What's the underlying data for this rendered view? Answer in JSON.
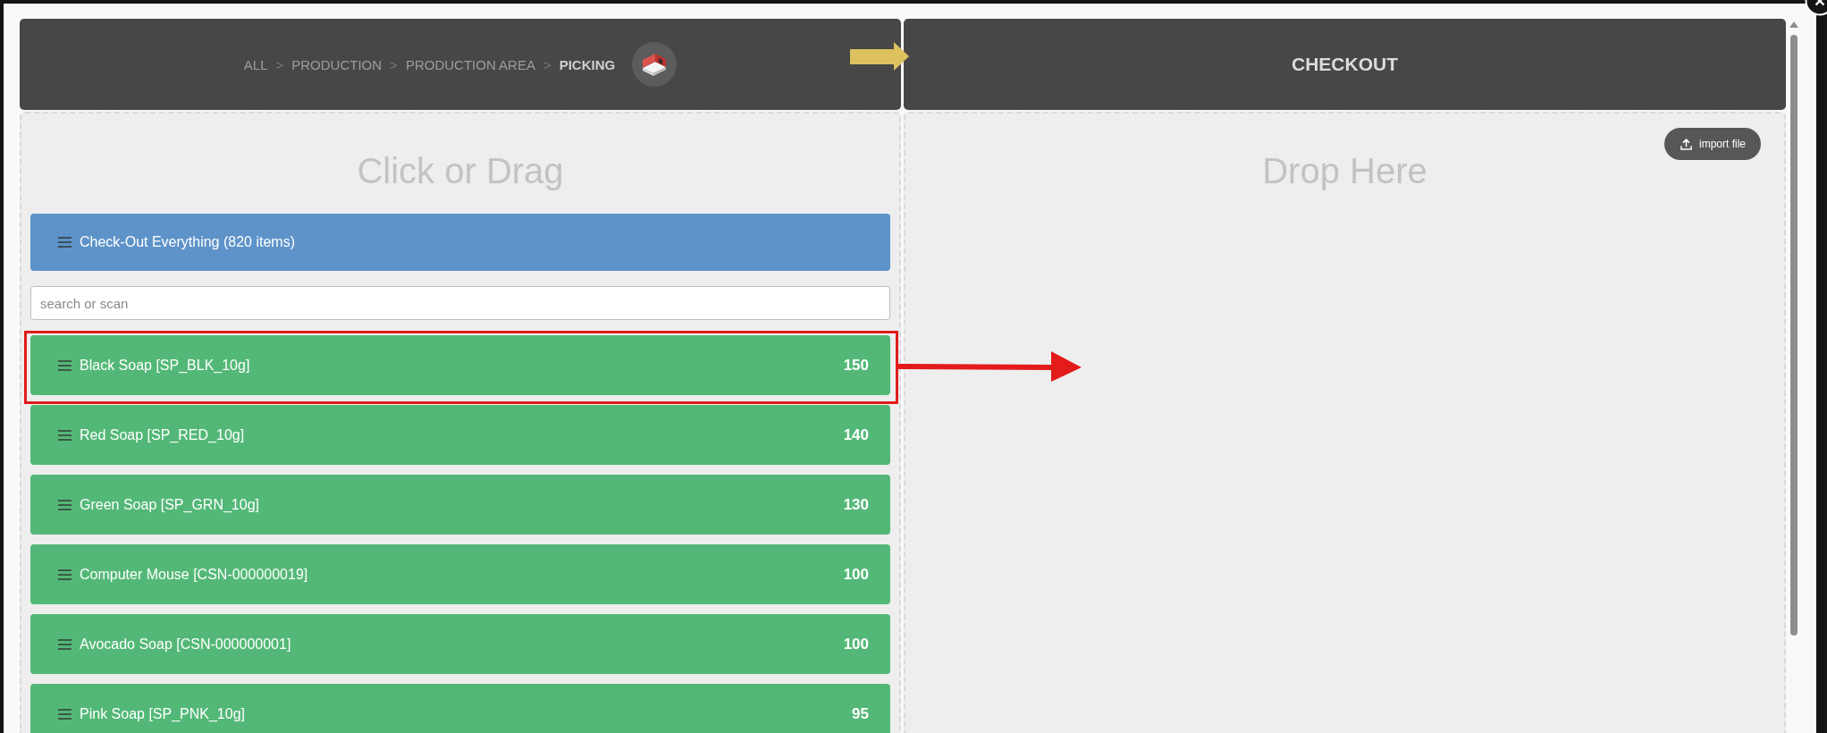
{
  "breadcrumb": [
    {
      "kind": "crumb",
      "label": "ALL",
      "current": false
    },
    {
      "kind": "separator",
      "label": ">"
    },
    {
      "kind": "crumb",
      "label": "PRODUCTION",
      "current": false
    },
    {
      "kind": "separator",
      "label": ">"
    },
    {
      "kind": "crumb",
      "label": "PRODUCTION AREA",
      "current": false
    },
    {
      "kind": "separator",
      "label": ">"
    },
    {
      "kind": "crumb",
      "label": "PICKING",
      "current": true
    }
  ],
  "source_panel": {
    "title": "Click or Drag",
    "checkout_all": {
      "label": "Check-Out Everything (820 items)"
    },
    "search": {
      "placeholder": "search or scan"
    },
    "items": [
      {
        "name": "Black Soap [SP_BLK_10g]",
        "quantity": "150",
        "highlighted": true
      },
      {
        "name": "Red Soap [SP_RED_10g]",
        "quantity": "140",
        "highlighted": false
      },
      {
        "name": "Green Soap [SP_GRN_10g]",
        "quantity": "130",
        "highlighted": false
      },
      {
        "name": "Computer Mouse [CSN-000000019]",
        "quantity": "100",
        "highlighted": false
      },
      {
        "name": "Avocado Soap [CSN-000000001]",
        "quantity": "100",
        "highlighted": false
      },
      {
        "name": "Pink Soap [SP_PNK_10g]",
        "quantity": "95",
        "highlighted": false
      }
    ]
  },
  "checkout_panel": {
    "header": "CHECKOUT",
    "title": "Drop Here",
    "import_button": {
      "label": "import file"
    }
  }
}
